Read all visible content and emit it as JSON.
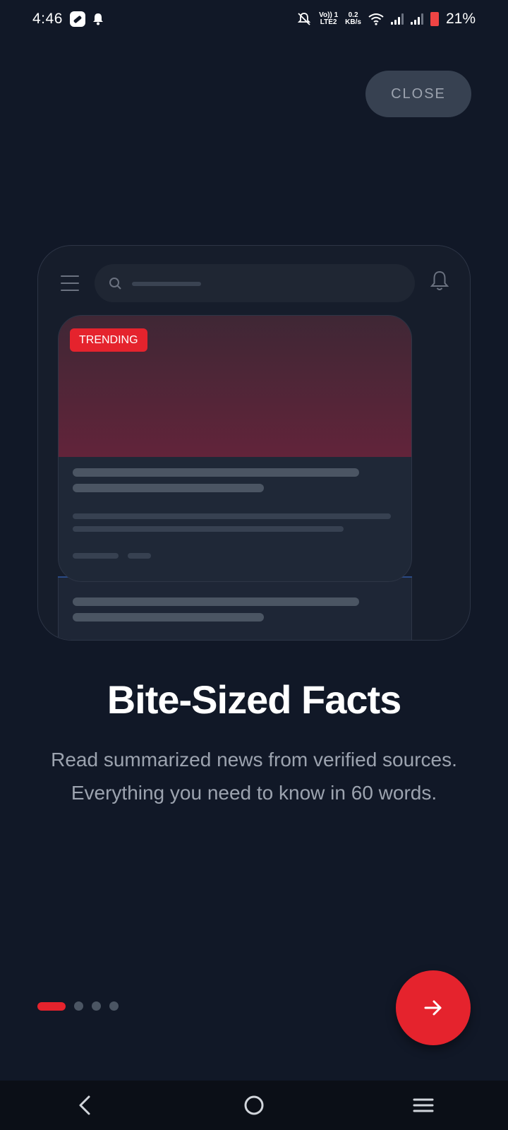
{
  "status_bar": {
    "time": "4:46",
    "network_top": "Vo)) 1",
    "network_bottom": "LTE2",
    "speed_value": "0.2",
    "speed_unit": "KB/s",
    "battery_percent": "21%"
  },
  "close_button": {
    "label": "CLOSE"
  },
  "mockup": {
    "badge_label": "TRENDING",
    "hero_color": "#62243a",
    "accent_stripe_color": "#2a4a86"
  },
  "slide": {
    "title": "Bite-Sized Facts",
    "description": "Read summarized news from verified sources. Everything you need to know in 60 words."
  },
  "pagination": {
    "total": 4,
    "active": 1
  },
  "colors": {
    "background": "#111827",
    "accent": "#e5232d",
    "muted_text": "#9ca3af"
  },
  "icons": {
    "next": "arrow-right-icon",
    "back": "back-chevron-icon",
    "home": "home-circle-icon",
    "recents": "recents-lines-icon"
  }
}
